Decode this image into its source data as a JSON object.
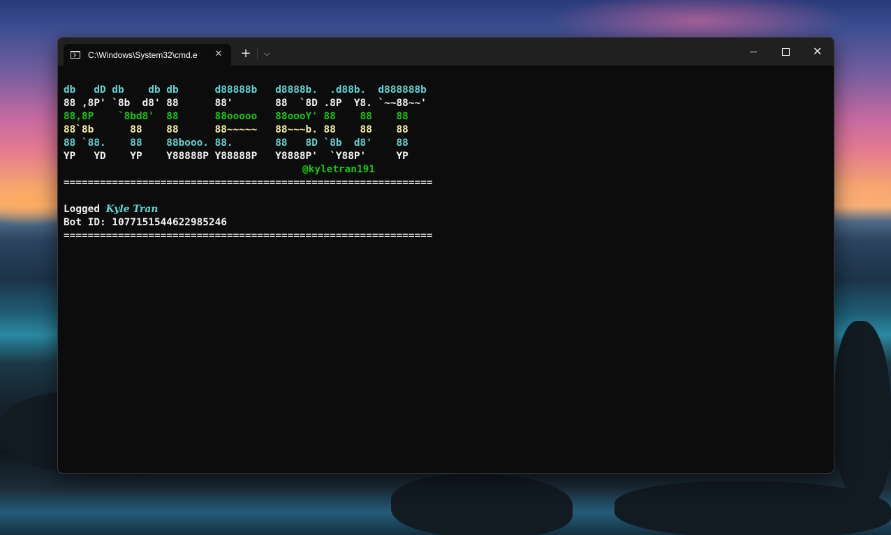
{
  "window": {
    "tab_title": "C:\\Windows\\System32\\cmd.e",
    "tab_close": "✕",
    "new_tab": "+",
    "dropdown": "⌵",
    "close_glyph": "✕"
  },
  "console": {
    "banner": [
      {
        "text": "db   dD db    db db      d88888b   d8888b.  .d88b.  d888888b",
        "color": "cyan"
      },
      {
        "text": "88 ,8P' `8b  d8' 88      88'       88  `8D .8P  Y8. `~~88~~'",
        "color": "white"
      },
      {
        "text": "88,8P    `8bd8'  88      88ooooo   88oooY' 88    88    88",
        "color": "green"
      },
      {
        "text": "88`8b      88    88      88~~~~~   88~~~b. 88    88    88",
        "color": "yellow"
      },
      {
        "text": "88 `88.    88    88booo. 88.       88   8D `8b  d8'    88",
        "color": "cyan"
      },
      {
        "text": "YP   YD    YP    Y88888P Y88888P   Y8888P'  `Y88P'     YP",
        "color": "white"
      }
    ],
    "handle": "@kyletran191",
    "separator": "=============================================================",
    "logged_label": "Logged ",
    "logged_name": "Kyle Tran",
    "bot_id_line": "Bot ID: 1077151544622985246",
    "separator_bottom": "============================================================="
  }
}
